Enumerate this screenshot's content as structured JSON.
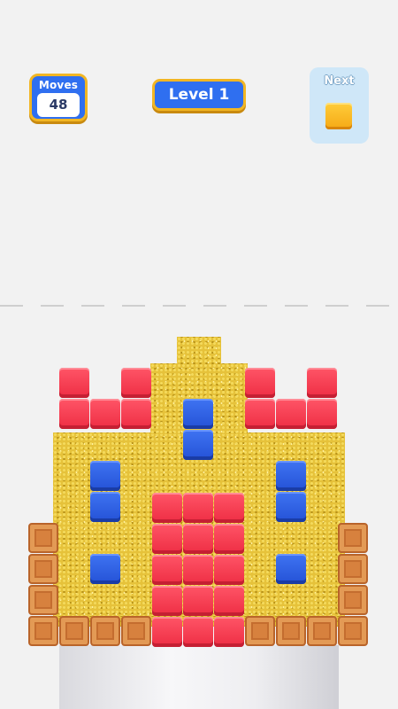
{
  "hud": {
    "moves_label": "Moves",
    "moves_value": "48",
    "level_label": "Level 1",
    "next_label": "Next",
    "next_block_color": "#f8b91f"
  },
  "colors": {
    "red": "#f23a4e",
    "blue": "#2d5fe3",
    "sand": "#e6c23a",
    "wood": "#d7813e",
    "accent_border": "#f2b623",
    "hud_blue": "#2f6ff0"
  }
}
